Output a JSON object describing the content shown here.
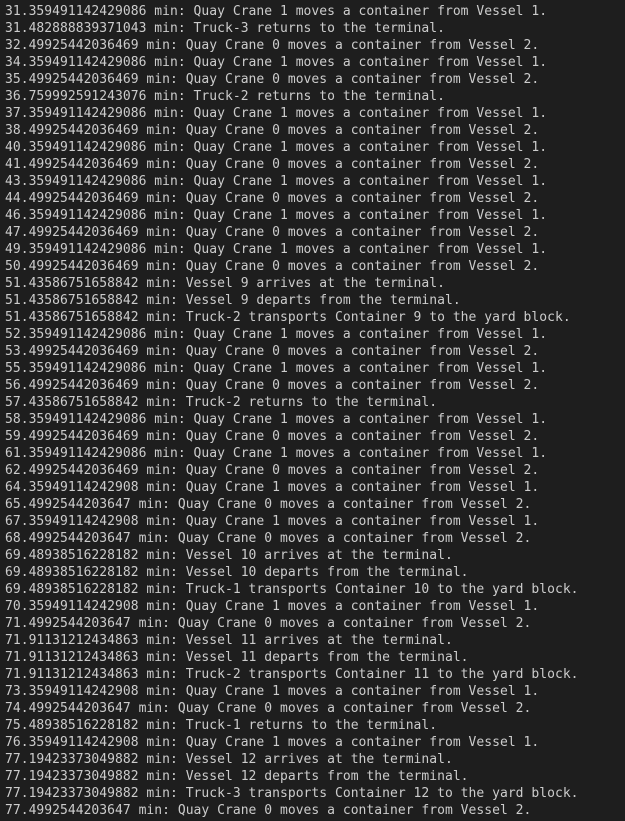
{
  "terminal": {
    "lines": [
      "31.359491142429086 min: Quay Crane 1 moves a container from Vessel 1.",
      "31.482888839371043 min: Truck-3 returns to the terminal.",
      "32.49925442036469 min: Quay Crane 0 moves a container from Vessel 2.",
      "34.359491142429086 min: Quay Crane 1 moves a container from Vessel 1.",
      "35.49925442036469 min: Quay Crane 0 moves a container from Vessel 2.",
      "36.759992591243076 min: Truck-2 returns to the terminal.",
      "37.359491142429086 min: Quay Crane 1 moves a container from Vessel 1.",
      "38.49925442036469 min: Quay Crane 0 moves a container from Vessel 2.",
      "40.359491142429086 min: Quay Crane 1 moves a container from Vessel 1.",
      "41.49925442036469 min: Quay Crane 0 moves a container from Vessel 2.",
      "43.359491142429086 min: Quay Crane 1 moves a container from Vessel 1.",
      "44.49925442036469 min: Quay Crane 0 moves a container from Vessel 2.",
      "46.359491142429086 min: Quay Crane 1 moves a container from Vessel 1.",
      "47.49925442036469 min: Quay Crane 0 moves a container from Vessel 2.",
      "49.359491142429086 min: Quay Crane 1 moves a container from Vessel 1.",
      "50.49925442036469 min: Quay Crane 0 moves a container from Vessel 2.",
      "51.43586751658842 min: Vessel 9 arrives at the terminal.",
      "51.43586751658842 min: Vessel 9 departs from the terminal.",
      "51.43586751658842 min: Truck-2 transports Container 9 to the yard block.",
      "52.359491142429086 min: Quay Crane 1 moves a container from Vessel 1.",
      "53.49925442036469 min: Quay Crane 0 moves a container from Vessel 2.",
      "55.359491142429086 min: Quay Crane 1 moves a container from Vessel 1.",
      "56.49925442036469 min: Quay Crane 0 moves a container from Vessel 2.",
      "57.43586751658842 min: Truck-2 returns to the terminal.",
      "58.359491142429086 min: Quay Crane 1 moves a container from Vessel 1.",
      "59.49925442036469 min: Quay Crane 0 moves a container from Vessel 2.",
      "61.359491142429086 min: Quay Crane 1 moves a container from Vessel 1.",
      "62.49925442036469 min: Quay Crane 0 moves a container from Vessel 2.",
      "64.35949114242908 min: Quay Crane 1 moves a container from Vessel 1.",
      "65.4992544203647 min: Quay Crane 0 moves a container from Vessel 2.",
      "67.35949114242908 min: Quay Crane 1 moves a container from Vessel 1.",
      "68.4992544203647 min: Quay Crane 0 moves a container from Vessel 2.",
      "69.48938516228182 min: Vessel 10 arrives at the terminal.",
      "69.48938516228182 min: Vessel 10 departs from the terminal.",
      "69.48938516228182 min: Truck-1 transports Container 10 to the yard block.",
      "70.35949114242908 min: Quay Crane 1 moves a container from Vessel 1.",
      "71.4992544203647 min: Quay Crane 0 moves a container from Vessel 2.",
      "71.91131212434863 min: Vessel 11 arrives at the terminal.",
      "71.91131212434863 min: Vessel 11 departs from the terminal.",
      "71.91131212434863 min: Truck-2 transports Container 11 to the yard block.",
      "73.35949114242908 min: Quay Crane 1 moves a container from Vessel 1.",
      "74.4992544203647 min: Quay Crane 0 moves a container from Vessel 2.",
      "75.48938516228182 min: Truck-1 returns to the terminal.",
      "76.35949114242908 min: Quay Crane 1 moves a container from Vessel 1.",
      "77.19423373049882 min: Vessel 12 arrives at the terminal.",
      "77.19423373049882 min: Vessel 12 departs from the terminal.",
      "77.19423373049882 min: Truck-3 transports Container 12 to the yard block.",
      "77.4992544203647 min: Quay Crane 0 moves a container from Vessel 2."
    ],
    "colors": {
      "background": "#1e1e1e",
      "text": "#cccccc"
    }
  }
}
